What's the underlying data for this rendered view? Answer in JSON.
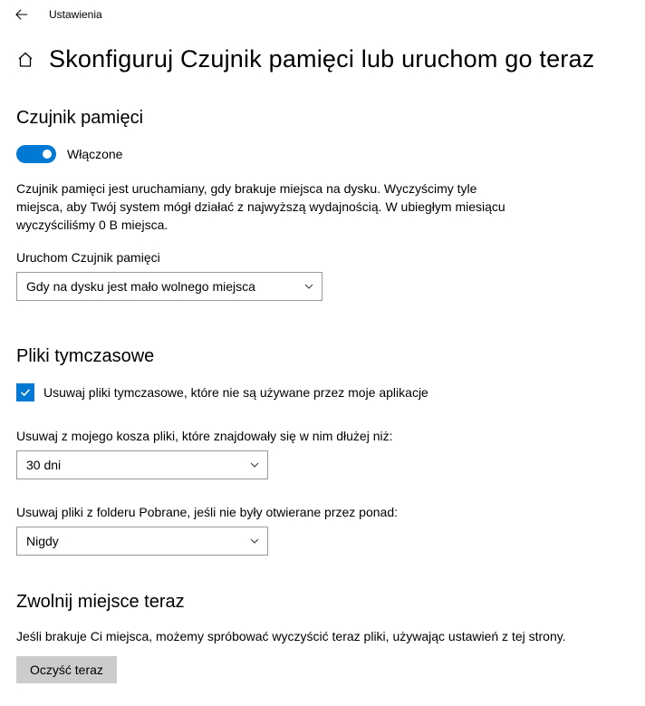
{
  "titlebar": {
    "title": "Ustawienia"
  },
  "header": {
    "page_title": "Skonfiguruj Czujnik pamięci lub uruchom go teraz"
  },
  "storage_sense": {
    "heading": "Czujnik pamięci",
    "toggle_label": "Włączone",
    "description": "Czujnik pamięci jest uruchamiany, gdy brakuje miejsca na dysku. Wyczyścimy tyle miejsca, aby Twój system mógł działać z najwyższą wydajnością. W ubiegłym miesiącu wyczyściliśmy 0 B miejsca.",
    "run_label": "Uruchom Czujnik pamięci",
    "run_value": "Gdy na dysku jest mało wolnego miejsca"
  },
  "temp_files": {
    "heading": "Pliki tymczasowe",
    "checkbox_label": "Usuwaj pliki tymczasowe, które nie są używane przez moje aplikacje",
    "recycle_label": "Usuwaj z mojego kosza pliki, które znajdowały się w nim dłużej niż:",
    "recycle_value": "30 dni",
    "downloads_label": "Usuwaj pliki z folderu Pobrane, jeśli nie były otwierane przez ponad:",
    "downloads_value": "Nigdy"
  },
  "free_now": {
    "heading": "Zwolnij miejsce teraz",
    "description": "Jeśli brakuje Ci miejsca, możemy spróbować wyczyścić teraz pliki, używając ustawień z tej strony.",
    "button": "Oczyść teraz"
  }
}
